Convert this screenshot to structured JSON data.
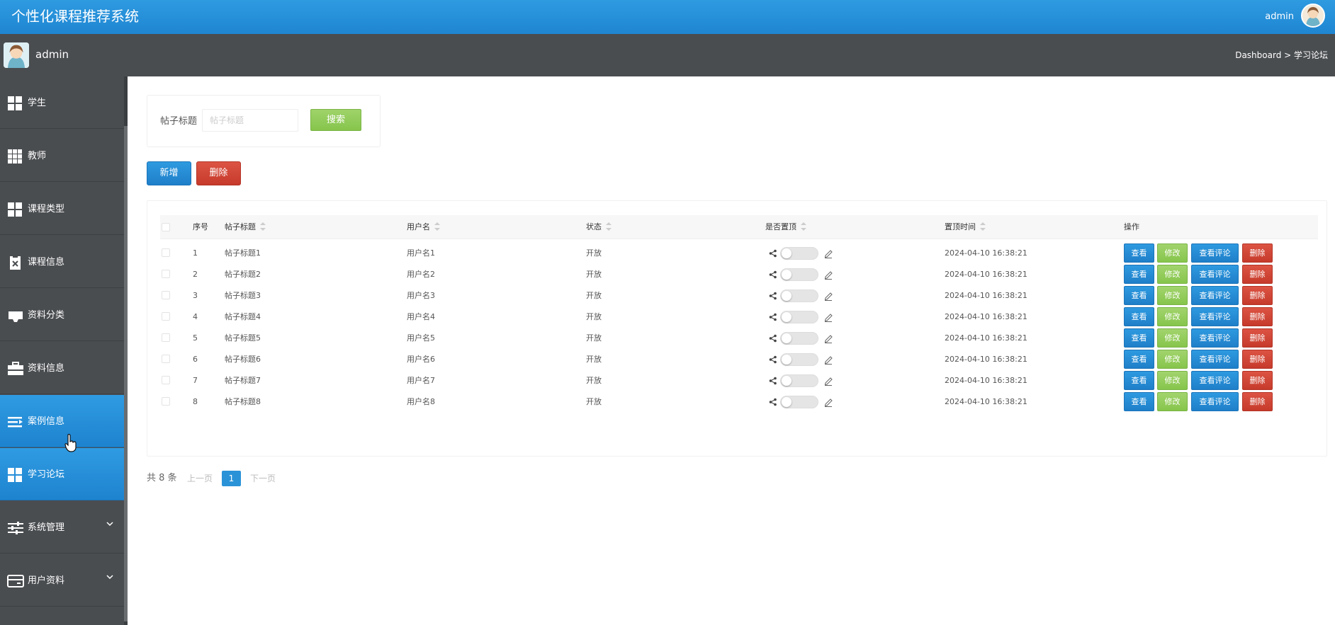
{
  "header": {
    "title": "个性化课程推荐系统",
    "user": "admin",
    "user_icon": "avatar-icon"
  },
  "subbar": {
    "username": "admin",
    "breadcrumb": "Dashboard > 学习论坛"
  },
  "sidebar": {
    "items": [
      {
        "label": "学生",
        "icon": "grid-icon"
      },
      {
        "label": "教师",
        "icon": "grid-9-icon"
      },
      {
        "label": "课程类型",
        "icon": "grid-icon"
      },
      {
        "label": "课程信息",
        "icon": "clipboard-x-icon"
      },
      {
        "label": "资料分类",
        "icon": "inbox-icon"
      },
      {
        "label": "资料信息",
        "icon": "briefcase-icon"
      },
      {
        "label": "案例信息",
        "icon": "list-icon",
        "active": true
      },
      {
        "label": "学习论坛",
        "icon": "grid-icon",
        "active": true
      },
      {
        "label": "系统管理",
        "icon": "sliders-icon",
        "expandable": true
      },
      {
        "label": "用户资料",
        "icon": "card-icon",
        "expandable": true
      }
    ]
  },
  "search": {
    "label": "帖子标题",
    "placeholder": "帖子标题",
    "value": "",
    "button": "搜索"
  },
  "toolbar": {
    "add": "新增",
    "delete": "删除"
  },
  "table": {
    "headers": {
      "index": "序号",
      "title": "帖子标题",
      "username": "用户名",
      "status": "状态",
      "pinned": "是否置顶",
      "pin_time": "置顶时间",
      "actions": "操作"
    },
    "actions": {
      "view": "查看",
      "edit": "修改",
      "comments": "查看评论",
      "delete": "删除"
    },
    "rows": [
      {
        "index": "1",
        "title": "帖子标题1",
        "username": "用户名1",
        "status": "开放",
        "pinned": false,
        "pin_time": "2024-04-10 16:38:21"
      },
      {
        "index": "2",
        "title": "帖子标题2",
        "username": "用户名2",
        "status": "开放",
        "pinned": false,
        "pin_time": "2024-04-10 16:38:21"
      },
      {
        "index": "3",
        "title": "帖子标题3",
        "username": "用户名3",
        "status": "开放",
        "pinned": false,
        "pin_time": "2024-04-10 16:38:21"
      },
      {
        "index": "4",
        "title": "帖子标题4",
        "username": "用户名4",
        "status": "开放",
        "pinned": false,
        "pin_time": "2024-04-10 16:38:21"
      },
      {
        "index": "5",
        "title": "帖子标题5",
        "username": "用户名5",
        "status": "开放",
        "pinned": false,
        "pin_time": "2024-04-10 16:38:21"
      },
      {
        "index": "6",
        "title": "帖子标题6",
        "username": "用户名6",
        "status": "开放",
        "pinned": false,
        "pin_time": "2024-04-10 16:38:21"
      },
      {
        "index": "7",
        "title": "帖子标题7",
        "username": "用户名7",
        "status": "开放",
        "pinned": false,
        "pin_time": "2024-04-10 16:38:21"
      },
      {
        "index": "8",
        "title": "帖子标题8",
        "username": "用户名8",
        "status": "开放",
        "pinned": false,
        "pin_time": "2024-04-10 16:38:21"
      }
    ]
  },
  "pagination": {
    "total": "共 8 条",
    "prev": "上一页",
    "current": "1",
    "next": "下一页"
  },
  "colors": {
    "primary": "#2a93d8",
    "success": "#86c54c",
    "danger": "#c63a2b",
    "sidebar": "#4a4d50"
  }
}
